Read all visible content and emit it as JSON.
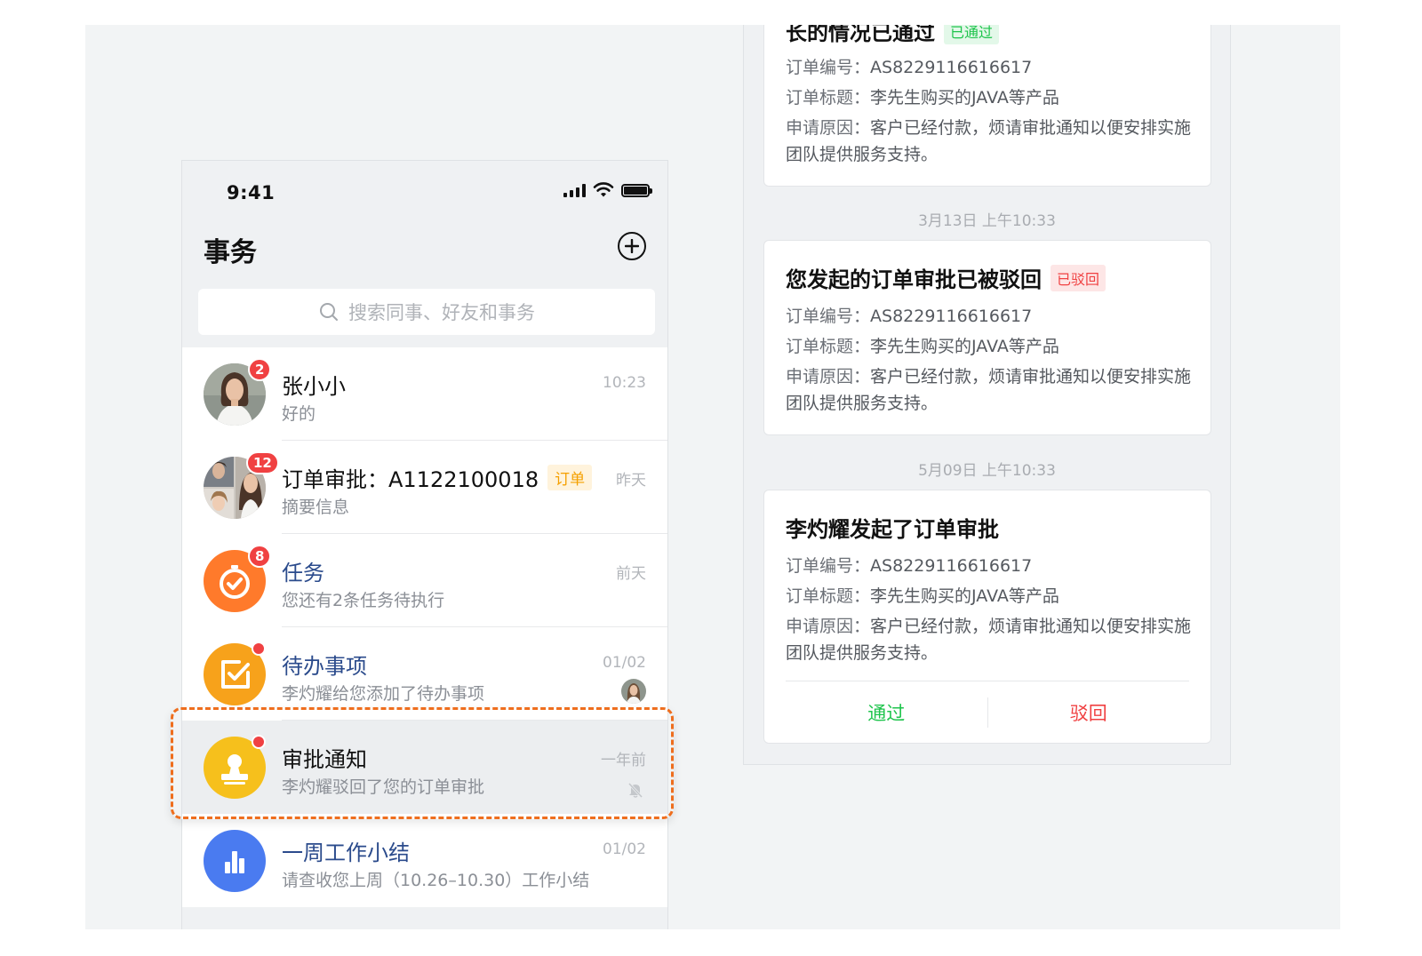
{
  "status_bar": {
    "time": "9:41"
  },
  "header": {
    "title": "事务"
  },
  "search": {
    "placeholder": "搜索同事、好友和事务"
  },
  "conversations": [
    {
      "title": "张小小",
      "subtitle": "好的",
      "time": "10:23",
      "badge": "2"
    },
    {
      "title": "订单审批：A1122100018",
      "tag": "订单",
      "subtitle": "摘要信息",
      "time": "昨天",
      "badge": "12"
    },
    {
      "title": "任务",
      "subtitle": "您还有2条任务待执行",
      "time": "前天",
      "badge": "8"
    },
    {
      "title": "待办事项",
      "subtitle": "李灼耀给您添加了待办事项",
      "time": "01/02"
    },
    {
      "title": "审批通知",
      "subtitle": "李灼耀驳回了您的订单审批",
      "time": "一年前"
    },
    {
      "title": "一周工作小结",
      "subtitle": "请查收您上周（10.26–10.30）工作小结",
      "time": "01/02"
    }
  ],
  "chat": {
    "cards": [
      {
        "title": "长的情况已通过",
        "tag": "已通过",
        "fields": [
          {
            "key": "订单编号：",
            "value": "AS8229116616617"
          },
          {
            "key": "订单标题：",
            "value": "李先生购买的JAVA等产品"
          },
          {
            "key": "申请原因：",
            "value": "客户已经付款，烦请审批通知以便安排实施团队提供服务支持。"
          }
        ]
      },
      {
        "timestamp": "3月13日 上午10:33",
        "title": "您发起的订单审批已被驳回",
        "tag": "已驳回",
        "fields": [
          {
            "key": "订单编号：",
            "value": "AS8229116616617"
          },
          {
            "key": "订单标题：",
            "value": "李先生购买的JAVA等产品"
          },
          {
            "key": "申请原因：",
            "value": "客户已经付款，烦请审批通知以便安排实施团队提供服务支持。"
          }
        ]
      },
      {
        "timestamp": "5月09日 上午10:33",
        "title": "李灼耀发起了订单审批",
        "fields": [
          {
            "key": "订单编号：",
            "value": "AS8229116616617"
          },
          {
            "key": "订单标题：",
            "value": "李先生购买的JAVA等产品"
          },
          {
            "key": "申请原因：",
            "value": "客户已经付款，烦请审批通知以便安排实施团队提供服务支持。"
          }
        ],
        "actions": {
          "approve": "通过",
          "reject": "驳回"
        }
      }
    ]
  },
  "colors": {
    "accent_orange": "#ee6e1e",
    "badge_red": "#f04142",
    "approve_green": "#1ec44c",
    "link_blue": "#2b4b8c",
    "task_orange": "#ff7a2b",
    "todo_orange": "#f7a21b",
    "notice_yellow": "#f6c01c",
    "report_blue": "#4a7bf0"
  },
  "icons": {
    "task": "stopwatch-icon",
    "todo": "checkbox-edit-icon",
    "notice": "stamp-icon",
    "report": "bar-chart-icon",
    "mute": "bell-off-icon"
  }
}
